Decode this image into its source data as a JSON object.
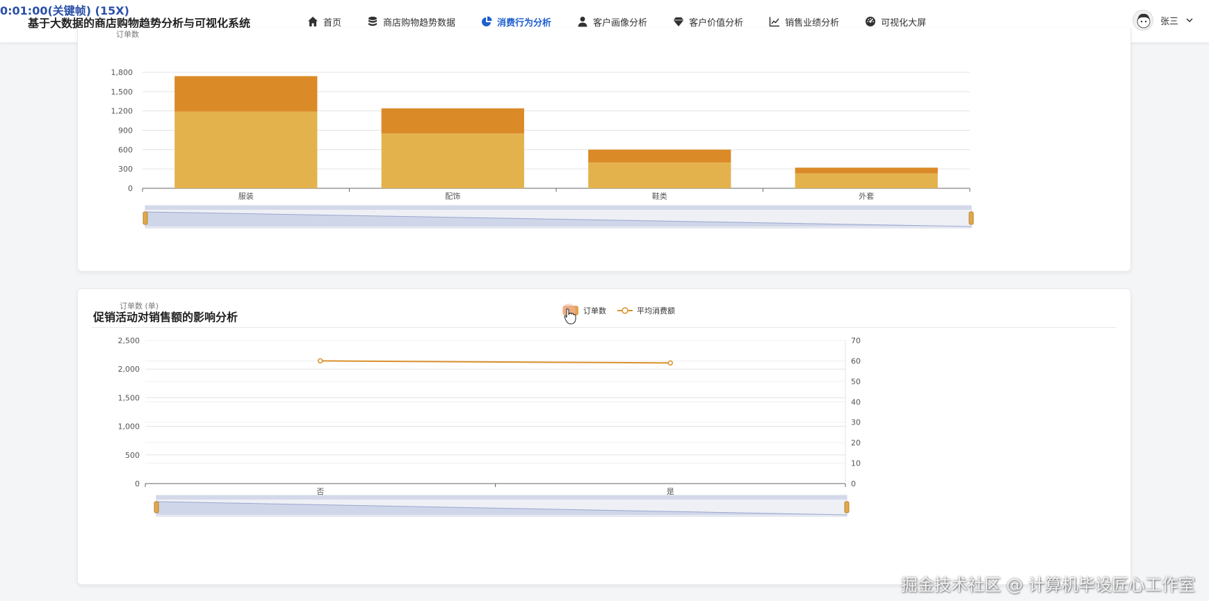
{
  "overlay": {
    "timestamp": "0:01:00(关键帧) (15X)"
  },
  "app": {
    "title": "基于大数据的商店购物趋势分析与可视化系统"
  },
  "nav": {
    "items": [
      {
        "label": "首页",
        "icon": "home-icon"
      },
      {
        "label": "商店购物趋势数据",
        "icon": "database-icon"
      },
      {
        "label": "消费行为分析",
        "icon": "pie-chart-icon",
        "active": true
      },
      {
        "label": "客户画像分析",
        "icon": "user-icon"
      },
      {
        "label": "客户价值分析",
        "icon": "diamond-icon"
      },
      {
        "label": "销售业绩分析",
        "icon": "line-chart-icon"
      },
      {
        "label": "可视化大屏",
        "icon": "dashboard-icon"
      }
    ],
    "accent": "#1f5fcf"
  },
  "user": {
    "name": "张三"
  },
  "card2": {
    "title": "促销活动对销售额的影响分析"
  },
  "chart_data": [
    {
      "type": "bar",
      "stacked": true,
      "categories": [
        "服装",
        "配饰",
        "鞋类",
        "外套"
      ],
      "series": [
        {
          "values": [
            1190,
            850,
            400,
            230
          ],
          "color": "#e4b24d"
        },
        {
          "values": [
            550,
            390,
            200,
            90
          ],
          "color": "#db8a28"
        }
      ],
      "ylim": [
        0,
        1800
      ],
      "yticks": [
        "0",
        "300",
        "600",
        "900",
        "1,200",
        "1,500",
        "1,800"
      ],
      "ylabel": "订单数",
      "grid": true,
      "datazoom": true
    },
    {
      "type": "bar+line",
      "categories": [
        "否",
        "是"
      ],
      "legend": {
        "items": [
          "订单数",
          "平均消费额"
        ],
        "position": "top-center"
      },
      "series": [
        {
          "name": "订单数",
          "type": "bar",
          "values": [
            0,
            0
          ],
          "hidden": true,
          "color": "#db8a28"
        },
        {
          "name": "平均消费额",
          "type": "line",
          "axis": "right",
          "values": [
            60,
            59
          ],
          "color": "#d9902b"
        }
      ],
      "ylim_left": [
        0,
        2500
      ],
      "yticks_left": [
        "0",
        "500",
        "1,000",
        "1,500",
        "2,000",
        "2,500"
      ],
      "ylim_right": [
        0,
        70
      ],
      "yticks_right": [
        "0",
        "10",
        "20",
        "30",
        "40",
        "50",
        "60",
        "70"
      ],
      "ylabel_left": "订单数 (单)",
      "grid": true,
      "datazoom": true
    }
  ],
  "watermark": "掘金技术社区 @ 计算机毕设匠心工作室"
}
